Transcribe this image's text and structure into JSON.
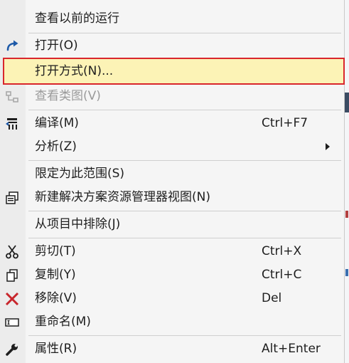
{
  "menu": {
    "items": [
      {
        "label": "查看以前的运行"
      },
      {
        "label": "打开(O)",
        "icon": "open-redo-icon"
      },
      {
        "label": "打开方式(N)...",
        "highlighted": true
      },
      {
        "label": "查看类图(V)",
        "disabled": true,
        "icon": "class-diagram-icon"
      },
      {
        "label": "编译(M)",
        "shortcut": "Ctrl+F7",
        "icon": "compile-icon"
      },
      {
        "label": "分析(Z)",
        "submenu": true
      },
      {
        "label": "限定为此范围(S)"
      },
      {
        "label": "新建解决方案资源管理器视图(N)",
        "icon": "new-explorer-view-icon"
      },
      {
        "label": "从项目中排除(J)"
      },
      {
        "label": "剪切(T)",
        "shortcut": "Ctrl+X",
        "icon": "scissors-icon"
      },
      {
        "label": "复制(Y)",
        "shortcut": "Ctrl+C",
        "icon": "copy-icon"
      },
      {
        "label": "移除(V)",
        "shortcut": "Del",
        "icon": "remove-x-icon"
      },
      {
        "label": "重命名(M)",
        "icon": "rename-icon"
      },
      {
        "label": "属性(R)",
        "shortcut": "Alt+Enter",
        "icon": "wrench-icon"
      }
    ]
  },
  "colors": {
    "menu_bg": "#f5f5f5",
    "highlight_bg": "#fcf3b6",
    "highlight_border": "#d9262c",
    "accent_blue": "#1e5aa8",
    "remove_red": "#c8262c"
  }
}
